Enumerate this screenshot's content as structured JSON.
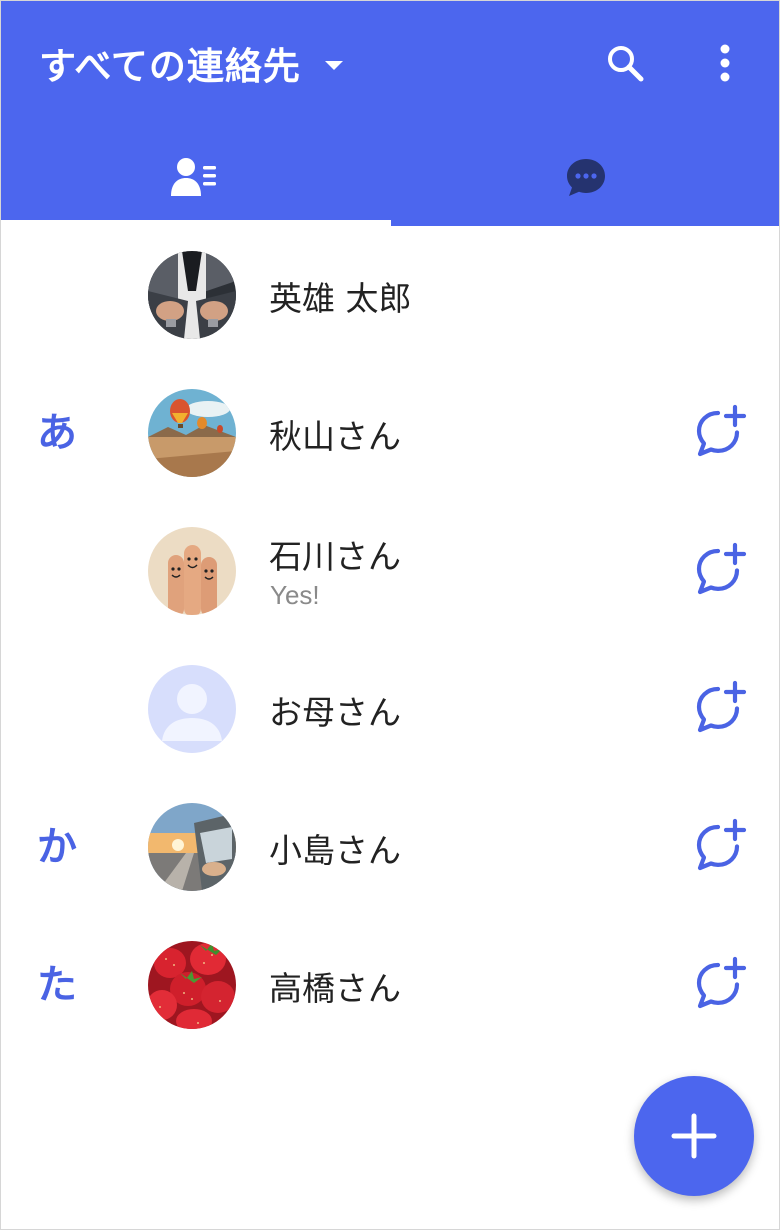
{
  "header": {
    "title": "すべての連絡先",
    "accent_color": "#4c66ee",
    "icons": {
      "search": "search-icon",
      "more": "more-vert-icon",
      "dropdown": "dropdown-caret-icon"
    }
  },
  "tabs": [
    {
      "name": "contacts",
      "icon": "contacts-icon",
      "selected": true
    },
    {
      "name": "chats",
      "icon": "chat-bubble-icon",
      "selected": false
    }
  ],
  "contacts": [
    {
      "section": "",
      "name": "英雄 太郎",
      "sub": "",
      "avatar": "photo-suit-cufflinks",
      "action": false
    },
    {
      "section": "あ",
      "name": "秋山さん",
      "sub": "",
      "avatar": "photo-hot-air-balloons",
      "action": true
    },
    {
      "section": "",
      "name": "石川さん",
      "sub": "Yes!",
      "avatar": "photo-finger-faces",
      "action": true
    },
    {
      "section": "",
      "name": "お母さん",
      "sub": "",
      "avatar": "default-person",
      "action": true
    },
    {
      "section": "か",
      "name": "小島さん",
      "sub": "",
      "avatar": "photo-car-sunset",
      "action": true
    },
    {
      "section": "た",
      "name": "高橋さん",
      "sub": "",
      "avatar": "photo-strawberries",
      "action": true
    }
  ],
  "fab": {
    "icon": "plus-icon"
  }
}
